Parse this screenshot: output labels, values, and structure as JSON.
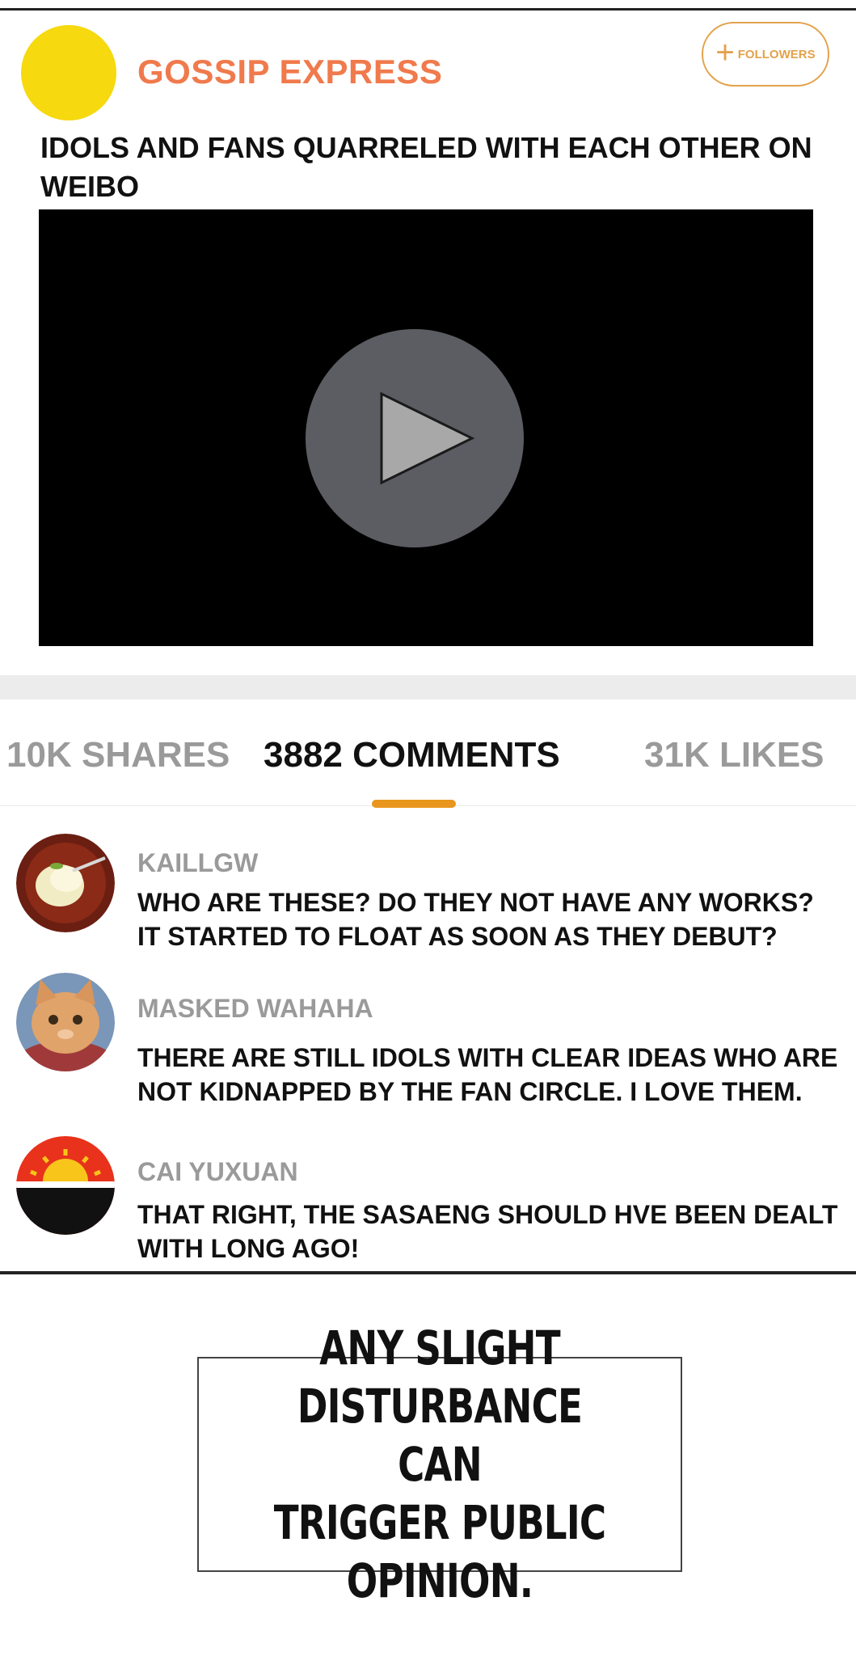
{
  "post": {
    "channel_name": "GOSSIP EXPRESS",
    "follow_label": "FOLLOWERS",
    "headline": "IDOLS AND FANS QUARRELED WITH EACH OTHER ON WEIBO"
  },
  "tabs": {
    "shares": "10K SHARES",
    "comments": "3882 COMMENTS",
    "likes": "31K LIKES",
    "active": "comments"
  },
  "comments": [
    {
      "username": "KAILLGW",
      "text": "WHO ARE THESE? DO THEY NOT HAVE ANY WORKS?\nIT STARTED TO FLOAT AS SOON AS THEY DEBUT?"
    },
    {
      "username": "MASKED WAHAHA",
      "text": "THERE ARE STILL IDOLS WITH CLEAR IDEAS WHO ARE\nNOT KIDNAPPED BY THE FAN CIRCLE. I LOVE THEM."
    },
    {
      "username": "CAI YUXUAN",
      "text": "THAT RIGHT, THE SASAENG SHOULD HVE BEEN DEALT\nWITH LONG AGO!"
    }
  ],
  "caption": "ANY SLIGHT\nDISTURBANCE CAN\nTRIGGER PUBLIC OPINION.",
  "colors": {
    "channel": "#f07a4c",
    "accent": "#e8961e",
    "avatar_main": "#f6d90e",
    "follow_border": "#e3a24b"
  },
  "icons": {
    "follow": "plus-icon",
    "video": "play-icon"
  }
}
